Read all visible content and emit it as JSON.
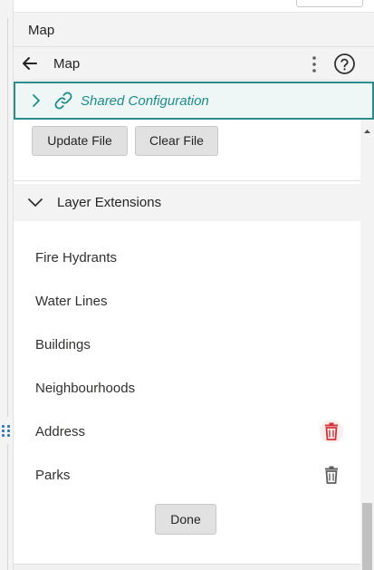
{
  "header": {
    "title": "Map"
  },
  "nav": {
    "title": "Map",
    "back_icon": "arrow-left-icon",
    "more_icon": "more-vertical-icon",
    "help_icon": "help-circle-icon"
  },
  "shared_config": {
    "label": "Shared Configuration",
    "icon": "link-icon",
    "color": "#1e8c8c"
  },
  "file_buttons": {
    "update_label": "Update File",
    "clear_label": "Clear File"
  },
  "layer_extensions": {
    "title": "Layer Extensions",
    "items": [
      {
        "label": "Fire Hydrants"
      },
      {
        "label": "Water Lines"
      },
      {
        "label": "Buildings"
      },
      {
        "label": "Neighbourhoods"
      },
      {
        "label": "Address",
        "delete_icon": "trash-icon",
        "delete_color": "#d13438"
      },
      {
        "label": "Parks",
        "delete_icon": "trash-icon",
        "delete_color": "#605e5c"
      }
    ],
    "done_label": "Done"
  }
}
